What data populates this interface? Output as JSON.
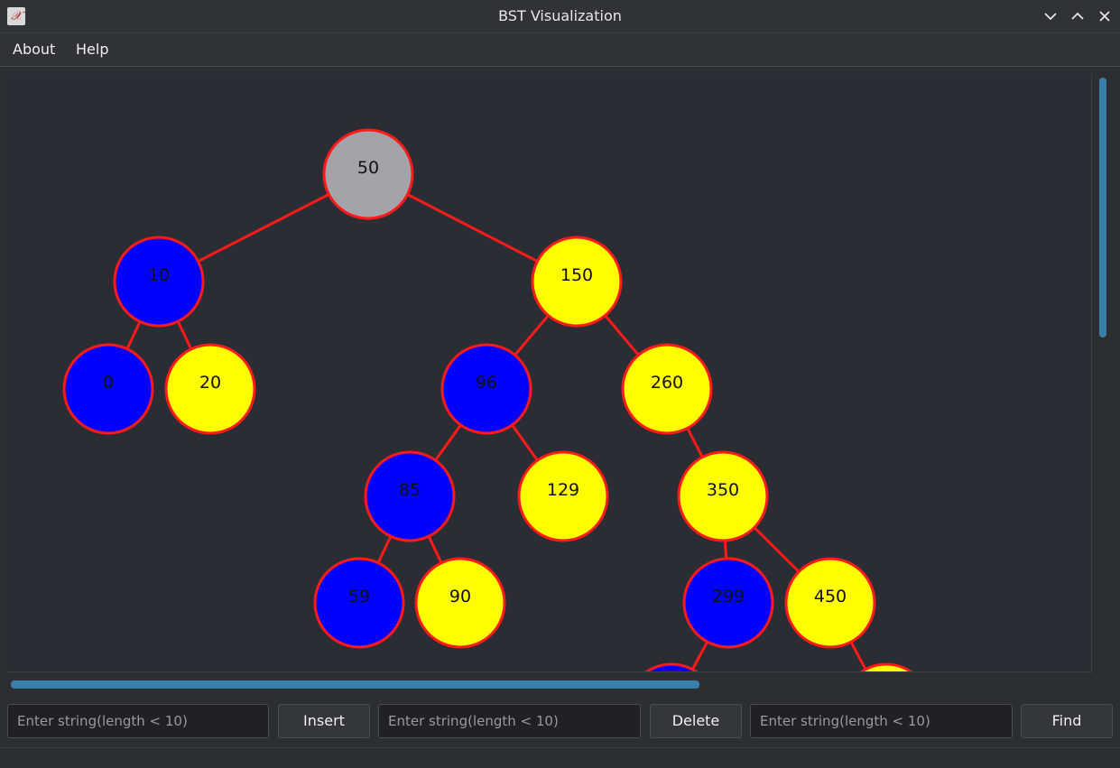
{
  "window": {
    "title": "BST Visualization"
  },
  "menu": [
    "About",
    "Help"
  ],
  "tree": {
    "colors": {
      "root": "#a4a3aa",
      "left": "#0000ff",
      "right": "#ffff00",
      "stroke": "#ff1a1a"
    },
    "nodes": [
      {
        "id": "50",
        "label": "50",
        "kind": "root"
      },
      {
        "id": "10",
        "label": "10",
        "kind": "left"
      },
      {
        "id": "150",
        "label": "150",
        "kind": "right"
      },
      {
        "id": "0",
        "label": "0",
        "kind": "left"
      },
      {
        "id": "20",
        "label": "20",
        "kind": "right"
      },
      {
        "id": "96",
        "label": "96",
        "kind": "left"
      },
      {
        "id": "260",
        "label": "260",
        "kind": "right"
      },
      {
        "id": "85",
        "label": "85",
        "kind": "left"
      },
      {
        "id": "129",
        "label": "129",
        "kind": "right"
      },
      {
        "id": "350",
        "label": "350",
        "kind": "right"
      },
      {
        "id": "59",
        "label": "59",
        "kind": "left"
      },
      {
        "id": "90",
        "label": "90",
        "kind": "right"
      },
      {
        "id": "299",
        "label": "299",
        "kind": "left"
      },
      {
        "id": "450",
        "label": "450",
        "kind": "right"
      },
      {
        "id": "c1",
        "label": "",
        "kind": "left"
      },
      {
        "id": "c2",
        "label": "",
        "kind": "right"
      }
    ],
    "edges": [
      [
        "50",
        "10"
      ],
      [
        "50",
        "150"
      ],
      [
        "10",
        "0"
      ],
      [
        "10",
        "20"
      ],
      [
        "150",
        "96"
      ],
      [
        "150",
        "260"
      ],
      [
        "96",
        "85"
      ],
      [
        "96",
        "129"
      ],
      [
        "260",
        "350"
      ],
      [
        "85",
        "59"
      ],
      [
        "85",
        "90"
      ],
      [
        "350",
        "299"
      ],
      [
        "350",
        "450"
      ],
      [
        "299",
        "c1"
      ],
      [
        "450",
        "c2"
      ]
    ]
  },
  "controls": {
    "insert": {
      "placeholder": "Enter string(length < 10)",
      "button": "Insert"
    },
    "delete": {
      "placeholder": "Enter string(length < 10)",
      "button": "Delete"
    },
    "find": {
      "placeholder": "Enter string(length < 10)",
      "button": "Find"
    }
  }
}
